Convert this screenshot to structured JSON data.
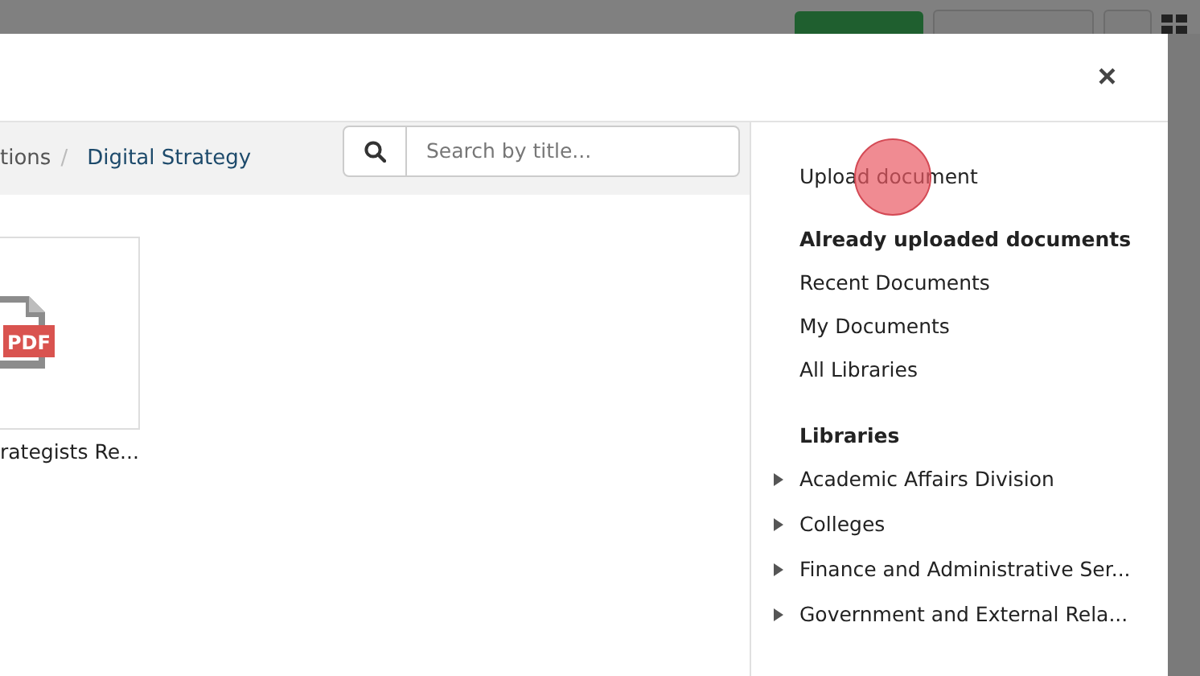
{
  "dialog": {
    "close": "×"
  },
  "breadcrumb": [
    {
      "label": "tions",
      "current": false
    },
    {
      "label": "Digital Strategy",
      "current": true
    }
  ],
  "breadcrumb_separator": "/",
  "search": {
    "placeholder": "Search by title..."
  },
  "documents": [
    {
      "kind": "pdf",
      "badge": "PDF",
      "title": "rategists Re..."
    }
  ],
  "sidebar": {
    "upload": "Upload document",
    "uploaded_heading": "Already uploaded documents",
    "uploaded_items": [
      "Recent Documents",
      "My Documents",
      "All Libraries"
    ],
    "libraries_heading": "Libraries",
    "libraries": [
      {
        "label": "Academic Affairs Division",
        "expanded": false
      },
      {
        "label": "Colleges",
        "expanded": false
      },
      {
        "label": "Finance and Administrative Ser...",
        "expanded": false
      },
      {
        "label": "Government and External Rela...",
        "expanded": false
      }
    ]
  }
}
